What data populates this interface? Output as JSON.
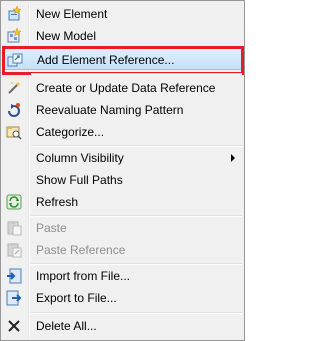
{
  "menu": {
    "new_element": "New Element",
    "new_model": "New Model",
    "add_element_reference": "Add Element Reference...",
    "create_update_data_reference": "Create or Update Data Reference",
    "reevaluate_naming_pattern": "Reevaluate Naming Pattern",
    "categorize": "Categorize...",
    "column_visibility": "Column Visibility",
    "show_full_paths": "Show Full Paths",
    "refresh": "Refresh",
    "paste": "Paste",
    "paste_reference": "Paste Reference",
    "import_from_file": "Import from File...",
    "export_to_file": "Export to File...",
    "delete_all": "Delete All..."
  },
  "state": {
    "highlighted_item": "add_element_reference",
    "disabled_items": [
      "paste",
      "paste_reference"
    ]
  },
  "colors": {
    "highlight_border": "#94c4ef",
    "focus_outline": "#e81c25"
  }
}
